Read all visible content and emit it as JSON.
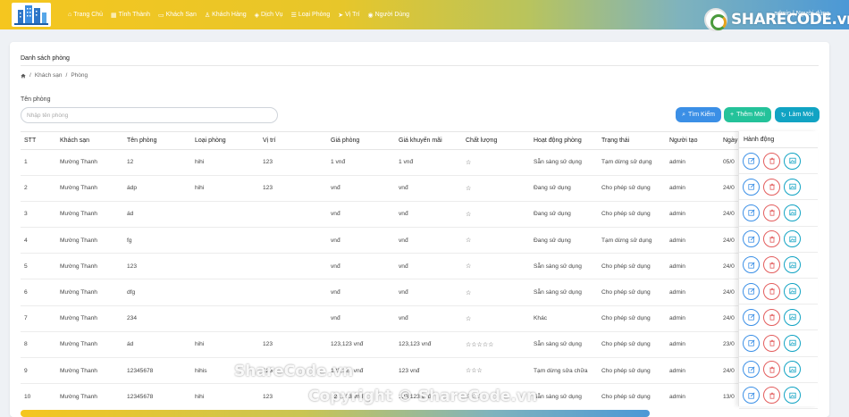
{
  "nav": {
    "items": [
      {
        "icon": "home-icon",
        "label": "Trang Chủ"
      },
      {
        "icon": "grid-icon",
        "label": "Tỉnh Thành"
      },
      {
        "icon": "bed-icon",
        "label": "Khách Sạn"
      },
      {
        "icon": "user-icon",
        "label": "Khách Hàng"
      },
      {
        "icon": "tag-icon",
        "label": "Dịch Vụ"
      },
      {
        "icon": "list-icon",
        "label": "Loại Phòng"
      },
      {
        "icon": "location-icon",
        "label": "Vị Trí"
      },
      {
        "icon": "group-icon",
        "label": "Người Dùng"
      }
    ],
    "user_label": "admin | Người dùng"
  },
  "watermark": {
    "logo_text": "SHARECODE.vn",
    "center_text": "ShareCode.vn",
    "copyright_text": "Copyright © ShareCode.vn"
  },
  "page": {
    "title": "Danh sách phòng",
    "breadcrumb": [
      "Khách sạn",
      "Phòng"
    ],
    "search_label": "Tên phòng",
    "search_placeholder": "Nhập tên phòng",
    "search_button": "Tìm Kiếm",
    "add_button": "Thêm Mới",
    "refresh_button": "Làm Mới"
  },
  "table": {
    "columns": [
      "STT",
      "Khách sạn",
      "Tên phòng",
      "Loại phòng",
      "Vị trí",
      "Giá phòng",
      "Giá khuyến mãi",
      "Chất lượng",
      "Hoạt động phòng",
      "Trạng thái",
      "Người tạo",
      "Ngày"
    ],
    "actions_header": "Hành động",
    "rows": [
      [
        "1",
        "Mường Thanh",
        "12",
        "hihi",
        "123",
        "1 vnđ",
        "1 vnđ",
        "☆",
        "Sẵn sàng sử dụng",
        "Tạm dừng sử dụng",
        "admin",
        "05/0"
      ],
      [
        "2",
        "Mường Thanh",
        "ádp",
        "hihi",
        "123",
        "vnđ",
        "vnđ",
        "☆",
        "Đang sử dụng",
        "Cho phép sử dụng",
        "admin",
        "24/0"
      ],
      [
        "3",
        "Mường Thanh",
        "ád",
        "",
        "",
        "vnđ",
        "vnđ",
        "☆",
        "Đang sử dụng",
        "Cho phép sử dụng",
        "admin",
        "24/0"
      ],
      [
        "4",
        "Mường Thanh",
        "fg",
        "",
        "",
        "vnđ",
        "vnđ",
        "☆",
        "Đang sử dụng",
        "Tạm dừng sử dụng",
        "admin",
        "24/0"
      ],
      [
        "5",
        "Mường Thanh",
        "123",
        "",
        "",
        "vnđ",
        "vnđ",
        "☆",
        "Sẵn sàng sử dụng",
        "Cho phép sử dụng",
        "admin",
        "24/0"
      ],
      [
        "6",
        "Mường Thanh",
        "dfg",
        "",
        "",
        "vnđ",
        "vnđ",
        "☆",
        "Sẵn sàng sử dụng",
        "Cho phép sử dụng",
        "admin",
        "24/0"
      ],
      [
        "7",
        "Mường Thanh",
        "234",
        "",
        "",
        "vnđ",
        "vnđ",
        "☆",
        "Khác",
        "Cho phép sử dụng",
        "admin",
        "24/0"
      ],
      [
        "8",
        "Mường Thanh",
        "ád",
        "hihi",
        "123",
        "123,123 vnđ",
        "123,123 vnđ",
        "☆☆☆☆☆",
        "Sẵn sàng sử dụng",
        "Cho phép sử dụng",
        "admin",
        "23/0"
      ],
      [
        "9",
        "Mường Thanh",
        "12345678",
        "hihis",
        "123",
        "123,123 vnđ",
        "123 vnđ",
        "☆☆☆",
        "Tạm dừng sửa chữa",
        "Cho phép sử dụng",
        "admin",
        "24/0"
      ],
      [
        "10",
        "Mường Thanh",
        "12345678",
        "hihi",
        "123",
        "123,123 vnđ",
        "123,123 vnđ",
        "☆☆☆",
        "Sẵn sàng sử dụng",
        "Cho phép sử dụng",
        "admin",
        "13/0"
      ]
    ]
  },
  "colors": {
    "search_button": "#3b8fe6",
    "add_button": "#24c29a",
    "refresh_button": "#11a3c3",
    "delete_action": "#e35d5d"
  }
}
